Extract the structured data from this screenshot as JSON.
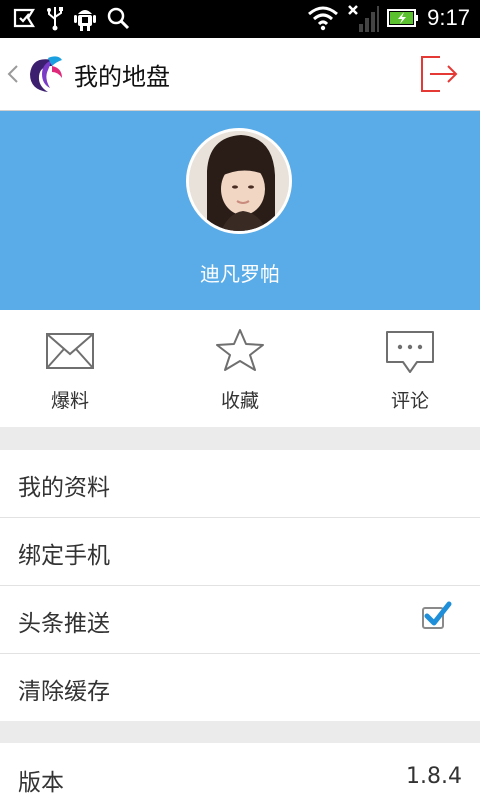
{
  "status_bar": {
    "time": "9:17",
    "icons": [
      "notification-icon",
      "usb-icon",
      "android-debug-icon",
      "search-icon",
      "wifi-icon",
      "signal-icon",
      "battery-charging-icon"
    ]
  },
  "header": {
    "title": "我的地盘",
    "logout_icon": "logout-icon",
    "accent": "#e53935"
  },
  "profile": {
    "username": "迪凡罗帕",
    "background": "#5aace8"
  },
  "actions": [
    {
      "label": "爆料",
      "icon": "envelope-icon"
    },
    {
      "label": "收藏",
      "icon": "star-icon"
    },
    {
      "label": "评论",
      "icon": "comment-icon"
    }
  ],
  "settings": {
    "my_profile": "我的资料",
    "bind_phone": "绑定手机",
    "headline_push": "头条推送",
    "headline_push_checked": true,
    "clear_cache": "清除缓存"
  },
  "about": {
    "version_label": "版本",
    "version_value": "1.8.4"
  }
}
